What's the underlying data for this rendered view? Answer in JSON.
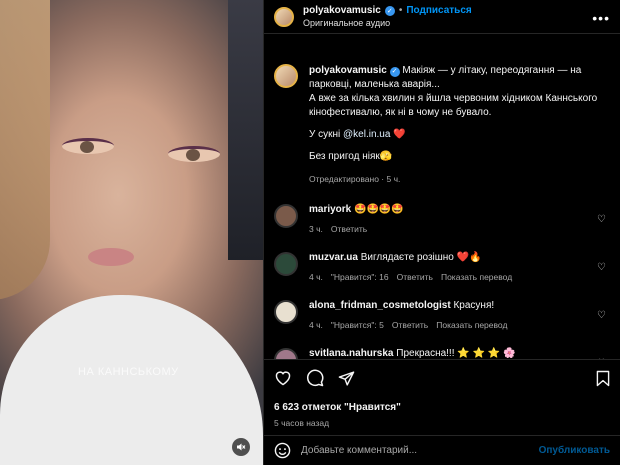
{
  "media": {
    "overlay_text": "НА КАННСЬКОМУ"
  },
  "header": {
    "username": "polyakovamusic",
    "follow_label": "Подписаться",
    "audio_label": "Оригинальное аудио"
  },
  "caption": {
    "username": "polyakovamusic",
    "line1": "Макіяж — у літаку, переодягання — на парковці, маленька аварія...",
    "line2": "А вже за кілька хвилин я йшла червоним хідником Каннського кінофестивалю, як ні в чому не бувало.",
    "dress_prefix": "У сукні ",
    "dress_link": "@kel.in.ua",
    "dress_heart": "❤️",
    "closing": "Без пригод ніяк🫣",
    "meta": "Отредактировано · 5 ч."
  },
  "comments": [
    {
      "username": "mariyork",
      "text": "🤩🤩🤩🤩",
      "time": "3 ч.",
      "likes": "",
      "reply": "Ответить",
      "translate": "",
      "avatar_color": "#7a5a4a"
    },
    {
      "username": "muzvar.ua",
      "text": "Виглядаєте розішно ❤️🔥",
      "time": "4 ч.",
      "likes": "\"Нравится\": 16",
      "reply": "Ответить",
      "translate": "Показать перевод",
      "avatar_color": "#2c4a3a"
    },
    {
      "username": "alona_fridman_cosmetologist",
      "text": "Красуня!",
      "time": "4 ч.",
      "likes": "\"Нравится\": 5",
      "reply": "Ответить",
      "translate": "Показать перевод",
      "avatar_color": "#e8e0d0"
    },
    {
      "username": "svitlana.nahurska",
      "text": "Прекрасна!!! ⭐ ⭐ ⭐ 🌸",
      "time": "",
      "likes": "",
      "reply": "",
      "translate": "",
      "avatar_color": "#a0788a"
    }
  ],
  "actions": {
    "likes": "6 623 отметок \"Нравится\"",
    "ago": "5 часов назад"
  },
  "add_comment": {
    "placeholder": "Добавьте комментарий...",
    "post_label": "Опубликовать"
  }
}
